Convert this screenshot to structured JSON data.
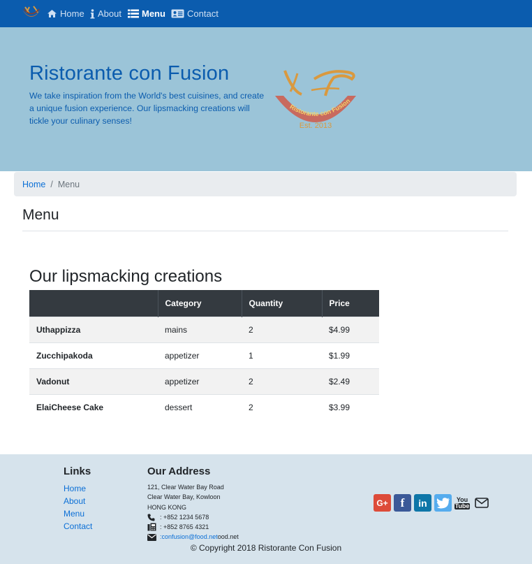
{
  "navbar": {
    "items": [
      {
        "label": "Home",
        "icon": "home-icon",
        "active": false
      },
      {
        "label": "About",
        "icon": "info-icon",
        "active": false
      },
      {
        "label": "Menu",
        "icon": "list-icon",
        "active": true
      },
      {
        "label": "Contact",
        "icon": "address-card-icon",
        "active": false
      }
    ]
  },
  "jumbotron": {
    "title": "Ristorante con Fusion",
    "text": "We take inspiration from the World's best cuisines, and create a unique fusion experience. Our lipsmacking creations will tickle your culinary senses!",
    "logo_text": "Ristorante con Fusion",
    "logo_est": "Est. 2013"
  },
  "breadcrumb": {
    "home": "Home",
    "separator": "/",
    "current": "Menu"
  },
  "page_title": "Menu",
  "section_title": "Our lipsmacking creations",
  "table": {
    "headers": [
      "",
      "Category",
      "Quantity",
      "Price"
    ],
    "rows": [
      [
        "Uthappizza",
        "mains",
        "2",
        "$4.99"
      ],
      [
        "Zucchipakoda",
        "appetizer",
        "1",
        "$1.99"
      ],
      [
        "Vadonut",
        "appetizer",
        "2",
        "$2.49"
      ],
      [
        "ElaiCheese Cake",
        "dessert",
        "2",
        "$3.99"
      ]
    ]
  },
  "footer": {
    "links_heading": "Links",
    "links": [
      "Home",
      "About",
      "Menu",
      "Contact"
    ],
    "address_heading": "Our Address",
    "address_lines": [
      "121, Clear Water Bay Road",
      "Clear Water Bay, Kowloon",
      "HONG KONG"
    ],
    "phone": ": +852 1234 5678",
    "fax": ": +852 8765 4321",
    "email_prefix": ": ",
    "email": "confusion@food.net",
    "email_suffix": "ood.net",
    "social": [
      "google-plus-icon",
      "facebook-icon",
      "linkedin-icon",
      "twitter-icon",
      "youtube-icon",
      "envelope-icon"
    ],
    "youtube_text": [
      "You",
      "Tube"
    ],
    "copyright": "© Copyright 2018 Ristorante Con Fusion"
  },
  "colors": {
    "navbar": "#0b5cae",
    "jumbotron": "#9bc4d8",
    "footer": "#d6e3ec",
    "table_header": "#343a40",
    "link": "#0b6fd6"
  }
}
